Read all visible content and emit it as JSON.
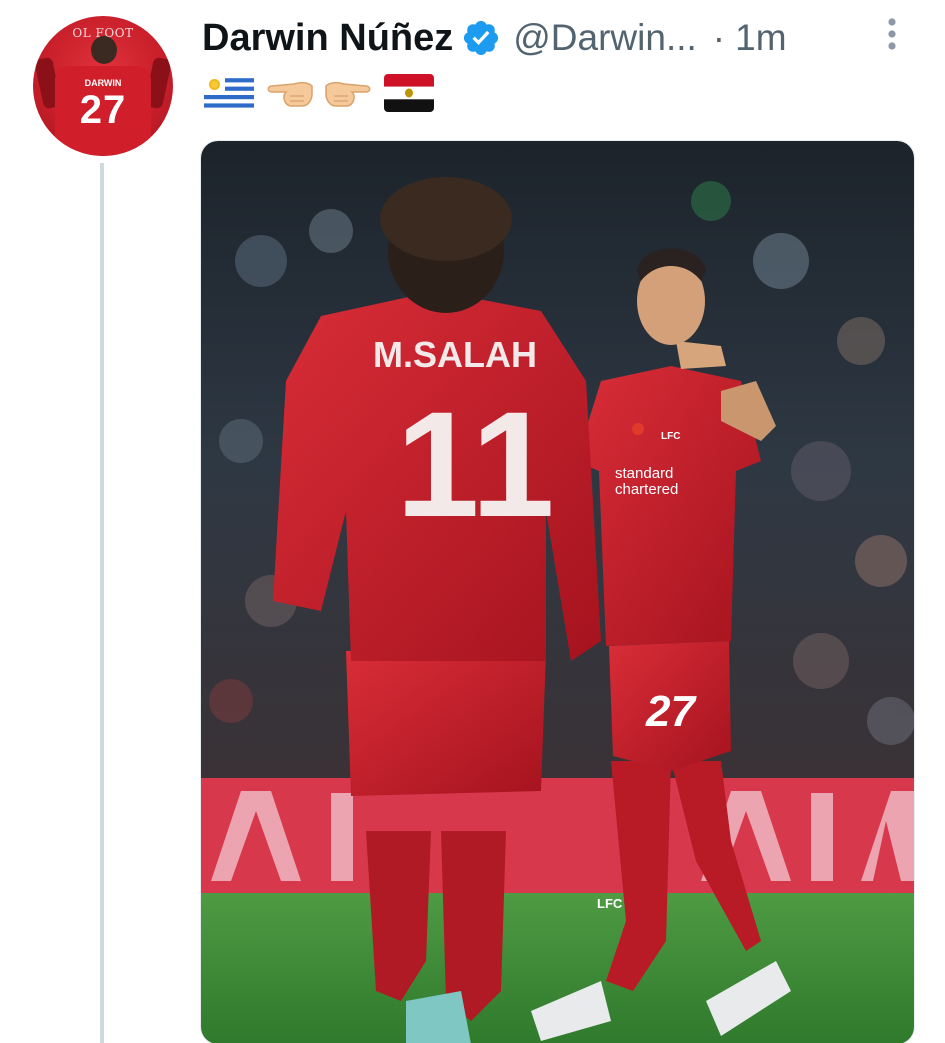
{
  "author": {
    "display_name": "Darwin Núñez",
    "handle": "@Darwin...",
    "verified": true,
    "avatar": {
      "banner_text": "OL FOOT",
      "shirt_name": "DARWIN",
      "shirt_number": "27"
    }
  },
  "timestamp": {
    "separator": "·",
    "relative": "1m"
  },
  "tweet_text_emojis": [
    "uruguay-flag",
    "backhand-pointing-left",
    "backhand-pointing-right",
    "egypt-flag"
  ],
  "media": {
    "left_player": {
      "name": "M.SALAH",
      "number": "11"
    },
    "right_player": {
      "sponsor_line1": "standard",
      "sponsor_line2": "chartered",
      "number": "27",
      "crest": "LFC",
      "sock_text": "LFC"
    }
  },
  "colors": {
    "name": "#0f1419",
    "secondary": "#536471",
    "verified_blue": "#1d9bf0",
    "thread_line": "#cfd9de",
    "kit_red": "#c8202c",
    "pitch_green": "#3e8f3a"
  }
}
